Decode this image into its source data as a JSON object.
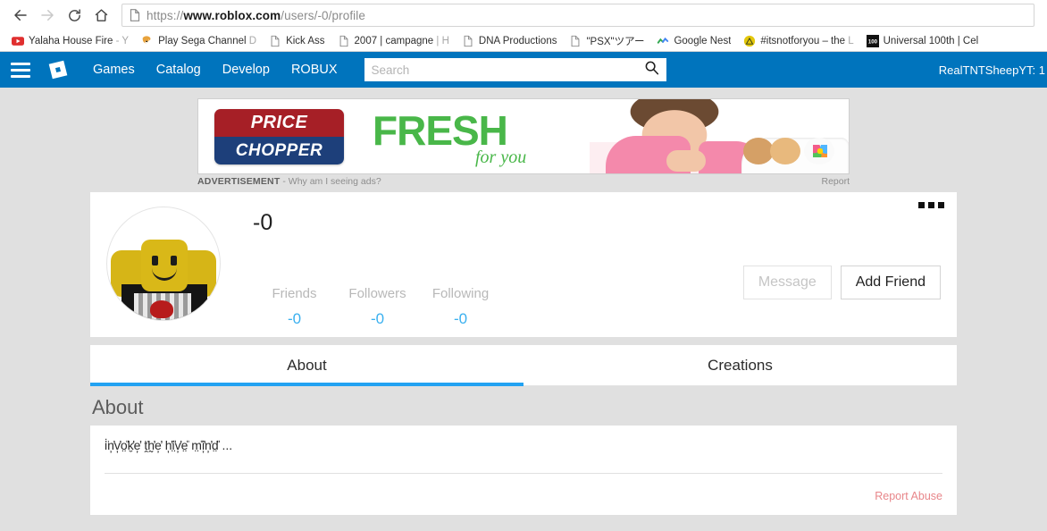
{
  "browser": {
    "nav": {
      "back_icon": "arrow-left-icon",
      "forward_icon": "arrow-right-icon",
      "reload_icon": "reload-icon",
      "home_icon": "home-icon"
    },
    "url": {
      "scheme": "https://",
      "host": "www.roblox.com",
      "path": "/users/-0/profile",
      "page_icon": "document-icon"
    },
    "bookmarks": [
      {
        "label": "Yalaha House Fire",
        "dim": " - Y",
        "icon": "youtube-icon"
      },
      {
        "label": "Play Sega Channel",
        "dim": " D",
        "icon": "sonic-icon"
      },
      {
        "label": "Kick Ass",
        "dim": "",
        "icon": "document-icon"
      },
      {
        "label": "2007 | campagne",
        "dim": " | H",
        "icon": "document-icon"
      },
      {
        "label": "DNA Productions",
        "dim": "",
        "icon": "document-icon"
      },
      {
        "label": "\"PSX\"ツアー",
        "dim": "",
        "icon": "document-icon"
      },
      {
        "label": "Google Nest",
        "dim": "",
        "icon": "nest-icon"
      },
      {
        "label": "#itsnotforyou – the",
        "dim": " L",
        "icon": "triangle-badge-icon"
      },
      {
        "label": "Universal 100th | Cel",
        "dim": "",
        "icon": "hundred-badge-icon"
      }
    ]
  },
  "roblox_nav": {
    "menu_icon": "hamburger-icon",
    "logo_icon": "roblox-logo-icon",
    "links": [
      "Games",
      "Catalog",
      "Develop",
      "ROBUX"
    ],
    "search_placeholder": "Search",
    "search_value": "",
    "search_icon": "search-icon",
    "user_label": "RealTNTSheepYT: 1",
    "accent_color": "#0074bd"
  },
  "advertisement": {
    "brand_line1": "PRICE",
    "brand_line2": "CHOPPER",
    "headline": "FRESH",
    "subhead": "for you",
    "label": "ADVERTISEMENT",
    "why_text": "- Why am I seeing ads?",
    "report_label": "Report"
  },
  "profile": {
    "avatar_icon": "roblox-avatar-icon",
    "username": "-0",
    "stats": [
      {
        "label": "Friends",
        "value": "-0"
      },
      {
        "label": "Followers",
        "value": "-0"
      },
      {
        "label": "Following",
        "value": "-0"
      }
    ],
    "message_button": "Message",
    "add_friend_button": "Add Friend",
    "menu_icon": "ellipsis-icon"
  },
  "tabs": [
    {
      "label": "About",
      "active": true
    },
    {
      "label": "Creations",
      "active": false
    }
  ],
  "about": {
    "section_title": "About",
    "description": "i̇̈n̦̓v̦̓o̤̎k̮̓e̦̓ ṱ̈h̰̓e̦̓ h̦̓i̤̎v̦̓e̤̎ m̤̎i̦̓n̦̓d̤̎ ...",
    "report_abuse": "Report Abuse",
    "report_abuse_color": "#e8868a"
  }
}
